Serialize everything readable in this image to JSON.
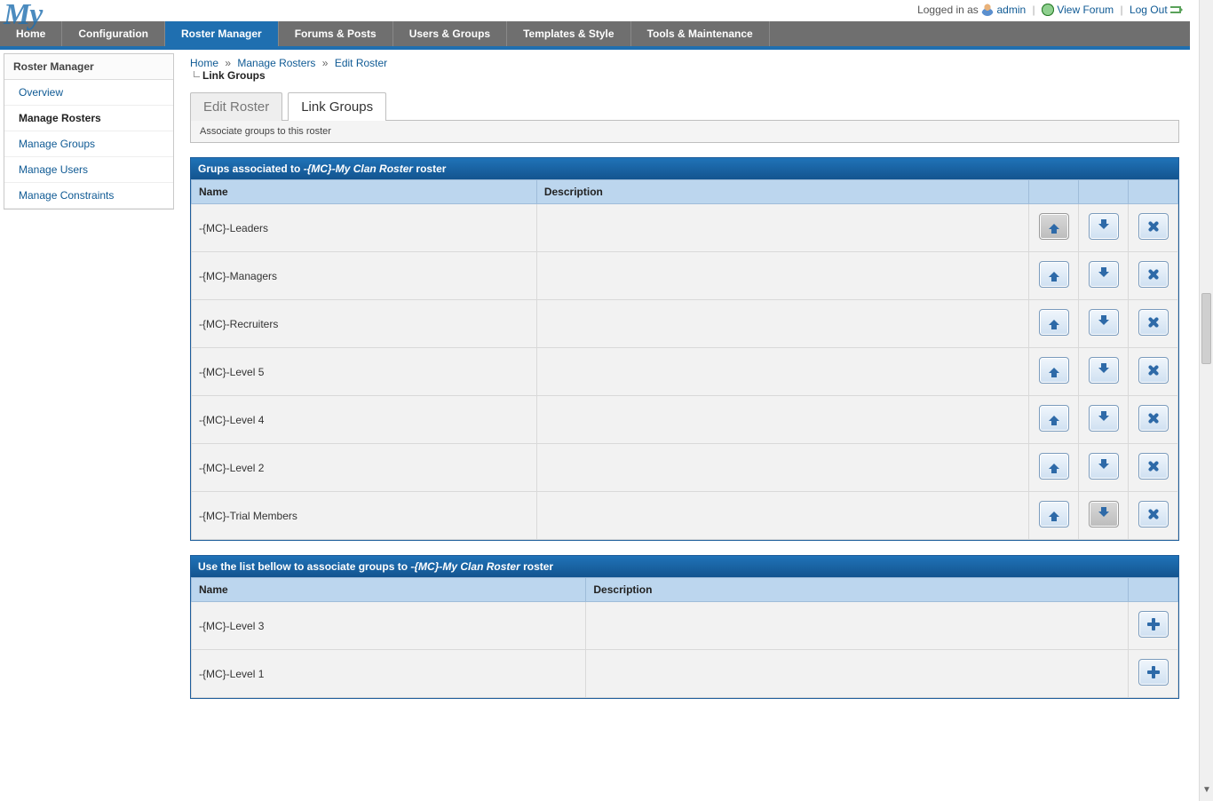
{
  "userbar": {
    "logged_in_as": "Logged in as",
    "username": "admin",
    "view_forum": "View Forum",
    "logout": "Log Out"
  },
  "mainnav": [
    {
      "label": "Home",
      "active": false
    },
    {
      "label": "Configuration",
      "active": false
    },
    {
      "label": "Roster Manager",
      "active": true
    },
    {
      "label": "Forums & Posts",
      "active": false
    },
    {
      "label": "Users & Groups",
      "active": false
    },
    {
      "label": "Templates & Style",
      "active": false
    },
    {
      "label": "Tools & Maintenance",
      "active": false
    }
  ],
  "sidebar": {
    "title": "Roster Manager",
    "items": [
      {
        "label": "Overview",
        "active": false
      },
      {
        "label": "Manage Rosters",
        "active": true
      },
      {
        "label": "Manage Groups",
        "active": false
      },
      {
        "label": "Manage Users",
        "active": false
      },
      {
        "label": "Manage Constraints",
        "active": false
      }
    ]
  },
  "breadcrumb": {
    "home": "Home",
    "manage_rosters": "Manage Rosters",
    "edit_roster": "Edit Roster",
    "sub": "Link Groups"
  },
  "page_tabs": {
    "edit_roster": "Edit Roster",
    "link_groups": "Link Groups",
    "desc": "Associate groups to this roster"
  },
  "assoc_panel": {
    "title_prefix": "Grups associated to ",
    "roster_name": "-{MC}-My Clan Roster",
    "title_suffix": " roster",
    "col_name": "Name",
    "col_desc": "Description",
    "rows": [
      {
        "name": "-{MC}-Leaders",
        "desc": "",
        "up_disabled": true,
        "down_disabled": false
      },
      {
        "name": "-{MC}-Managers",
        "desc": "",
        "up_disabled": false,
        "down_disabled": false
      },
      {
        "name": "-{MC}-Recruiters",
        "desc": "",
        "up_disabled": false,
        "down_disabled": false
      },
      {
        "name": "-{MC}-Level 5",
        "desc": "",
        "up_disabled": false,
        "down_disabled": false
      },
      {
        "name": "-{MC}-Level 4",
        "desc": "",
        "up_disabled": false,
        "down_disabled": false
      },
      {
        "name": "-{MC}-Level 2",
        "desc": "",
        "up_disabled": false,
        "down_disabled": false
      },
      {
        "name": "-{MC}-Trial Members",
        "desc": "",
        "up_disabled": false,
        "down_disabled": true
      }
    ]
  },
  "avail_panel": {
    "title_prefix": "Use the list bellow to associate groups to ",
    "roster_name": "-{MC}-My Clan Roster",
    "title_suffix": " roster",
    "col_name": "Name",
    "col_desc": "Description",
    "rows": [
      {
        "name": "-{MC}-Level 3",
        "desc": ""
      },
      {
        "name": "-{MC}-Level 1",
        "desc": ""
      }
    ]
  }
}
